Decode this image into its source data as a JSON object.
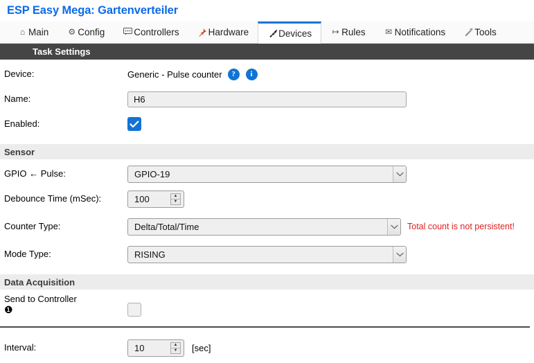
{
  "header": {
    "title": "ESP Easy Mega: Gartenverteiler"
  },
  "tabs": [
    {
      "label": "Main",
      "icon": "home-icon",
      "glyph": "⌂",
      "active": false
    },
    {
      "label": "Config",
      "icon": "gear-icon",
      "glyph": "⚙",
      "active": false
    },
    {
      "label": "Controllers",
      "icon": "chat-icon",
      "glyph": "὞9",
      "active": false
    },
    {
      "label": "Hardware",
      "icon": "pushpin-icon",
      "glyph": "ὌC",
      "active": false
    },
    {
      "label": "Devices",
      "icon": "plug-icon",
      "glyph": "ὐC",
      "active": true
    },
    {
      "label": "Rules",
      "icon": "arrow-icon",
      "glyph": "↦",
      "active": false
    },
    {
      "label": "Notifications",
      "icon": "envelope-icon",
      "glyph": "✉",
      "active": false
    },
    {
      "label": "Tools",
      "icon": "wrench-icon",
      "glyph": "ὒ7",
      "active": false
    }
  ],
  "task_settings": {
    "section_title": "Task Settings",
    "device": {
      "label": "Device:",
      "value": "Generic - Pulse counter",
      "help_icon": "?",
      "info_icon": "i"
    },
    "name": {
      "label": "Name:",
      "value": "H6",
      "placeholder": ""
    },
    "enabled": {
      "label": "Enabled:",
      "checked": true
    }
  },
  "sensor": {
    "section_title": "Sensor",
    "gpio": {
      "label": "GPIO ← Pulse:",
      "value": "GPIO-19"
    },
    "debounce": {
      "label": "Debounce Time (mSec):",
      "value": "100"
    },
    "counter_type": {
      "label": "Counter Type:",
      "value": "Delta/Total/Time",
      "warning": "Total count is not persistent!"
    },
    "mode_type": {
      "label": "Mode Type:",
      "value": "RISING"
    }
  },
  "data_acquisition": {
    "section_title": "Data Acquisition",
    "send_to_controller": {
      "label": "Send to Controller",
      "index": "❶",
      "checked": false
    },
    "interval": {
      "label": "Interval:",
      "value": "10",
      "unit": "[sec]"
    }
  },
  "colors": {
    "title_blue": "#0b6ae8",
    "tab_active_border": "#1a73d4",
    "dark_bar": "#454545",
    "light_bar": "#ececec",
    "warning_red": "#e02020",
    "checkbox_blue": "#1273d4"
  }
}
